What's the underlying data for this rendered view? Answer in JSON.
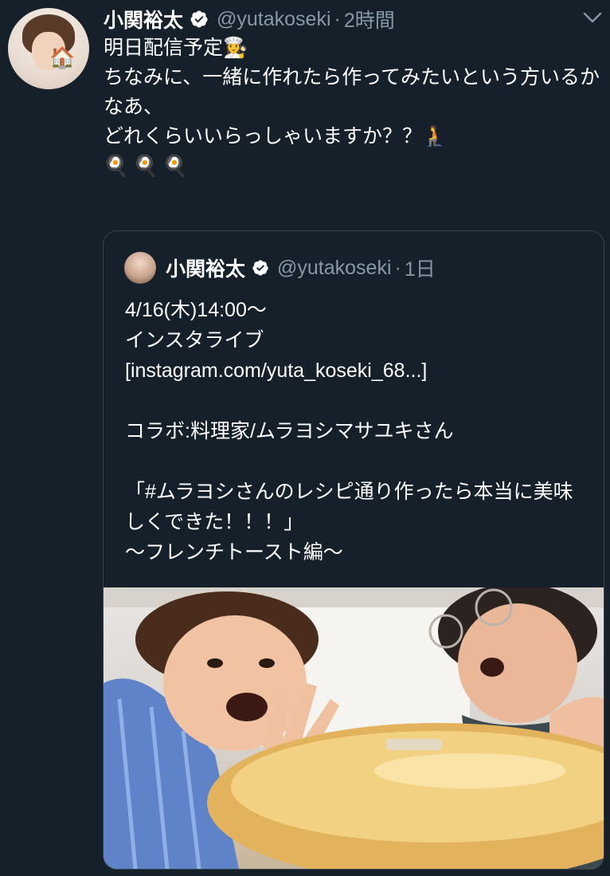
{
  "tweet": {
    "author_name": "小関裕太",
    "handle": "@yutakoseki",
    "separator": "·",
    "time": "2時間",
    "lines": [
      "明日配信予定👩‍🍳",
      "ちなみに、一緒に作れたら作ってみたいという方いるかなあ、",
      "どれくらいいらっしゃいますか？？🧎"
    ],
    "emoji_line": "🍳🍳🍳"
  },
  "quoted_tweet": {
    "author_name": "小関裕太",
    "handle": "@yutakoseki",
    "separator": "·",
    "time": "1日",
    "line1": "4/16(木)14:00〜",
    "line2": "インスタライブ",
    "line3": "[instagram.com/yuta_koseki_68...]",
    "line4": "コラボ:料理家/ムラヨシマサユキさん",
    "line5": "「#ムラヨシさんのレシピ通り作ったら本当に美味しくできた！！！」",
    "line6": "〜フレンチトースト編〜"
  },
  "icons": {
    "verified": "verified-badge-icon",
    "menu": "chevron-down-icon"
  },
  "colors": {
    "background": "#15202b",
    "secondary_text": "#8899a6",
    "border": "#38444d",
    "verified_badge": "#ffffff"
  }
}
